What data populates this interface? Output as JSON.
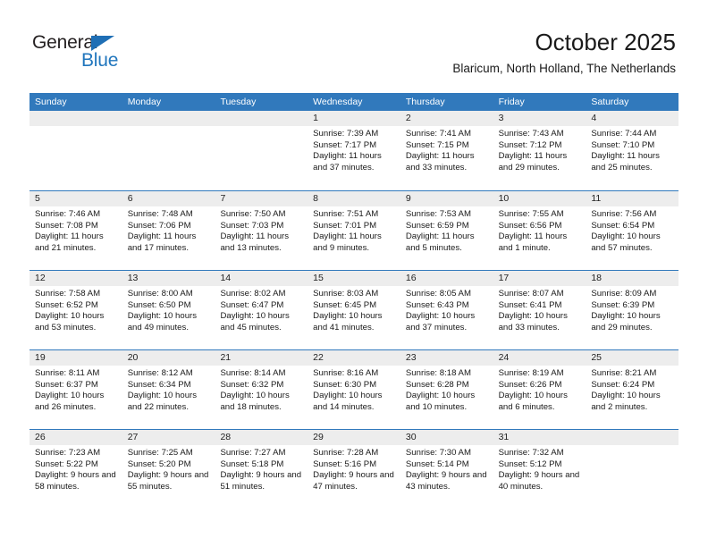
{
  "brand": {
    "name_top": "General",
    "name_bottom": "Blue"
  },
  "header": {
    "title": "October 2025",
    "subtitle": "Blaricum, North Holland, The Netherlands"
  },
  "weekdays": [
    "Sunday",
    "Monday",
    "Tuesday",
    "Wednesday",
    "Thursday",
    "Friday",
    "Saturday"
  ],
  "colors": {
    "header_blue": "#3179bc",
    "logo_blue": "#2176bd",
    "day_strip_gray": "#ededed"
  },
  "labels": {
    "sunrise_prefix": "Sunrise:",
    "sunset_prefix": "Sunset:",
    "daylight_prefix": "Daylight:"
  },
  "weeks": [
    [
      {
        "day": "",
        "empty": true
      },
      {
        "day": "",
        "empty": true
      },
      {
        "day": "",
        "empty": true
      },
      {
        "day": "1",
        "sunrise": "Sunrise: 7:39 AM",
        "sunset": "Sunset: 7:17 PM",
        "daylight": "Daylight: 11 hours and 37 minutes."
      },
      {
        "day": "2",
        "sunrise": "Sunrise: 7:41 AM",
        "sunset": "Sunset: 7:15 PM",
        "daylight": "Daylight: 11 hours and 33 minutes."
      },
      {
        "day": "3",
        "sunrise": "Sunrise: 7:43 AM",
        "sunset": "Sunset: 7:12 PM",
        "daylight": "Daylight: 11 hours and 29 minutes."
      },
      {
        "day": "4",
        "sunrise": "Sunrise: 7:44 AM",
        "sunset": "Sunset: 7:10 PM",
        "daylight": "Daylight: 11 hours and 25 minutes."
      }
    ],
    [
      {
        "day": "5",
        "sunrise": "Sunrise: 7:46 AM",
        "sunset": "Sunset: 7:08 PM",
        "daylight": "Daylight: 11 hours and 21 minutes."
      },
      {
        "day": "6",
        "sunrise": "Sunrise: 7:48 AM",
        "sunset": "Sunset: 7:06 PM",
        "daylight": "Daylight: 11 hours and 17 minutes."
      },
      {
        "day": "7",
        "sunrise": "Sunrise: 7:50 AM",
        "sunset": "Sunset: 7:03 PM",
        "daylight": "Daylight: 11 hours and 13 minutes."
      },
      {
        "day": "8",
        "sunrise": "Sunrise: 7:51 AM",
        "sunset": "Sunset: 7:01 PM",
        "daylight": "Daylight: 11 hours and 9 minutes."
      },
      {
        "day": "9",
        "sunrise": "Sunrise: 7:53 AM",
        "sunset": "Sunset: 6:59 PM",
        "daylight": "Daylight: 11 hours and 5 minutes."
      },
      {
        "day": "10",
        "sunrise": "Sunrise: 7:55 AM",
        "sunset": "Sunset: 6:56 PM",
        "daylight": "Daylight: 11 hours and 1 minute."
      },
      {
        "day": "11",
        "sunrise": "Sunrise: 7:56 AM",
        "sunset": "Sunset: 6:54 PM",
        "daylight": "Daylight: 10 hours and 57 minutes."
      }
    ],
    [
      {
        "day": "12",
        "sunrise": "Sunrise: 7:58 AM",
        "sunset": "Sunset: 6:52 PM",
        "daylight": "Daylight: 10 hours and 53 minutes."
      },
      {
        "day": "13",
        "sunrise": "Sunrise: 8:00 AM",
        "sunset": "Sunset: 6:50 PM",
        "daylight": "Daylight: 10 hours and 49 minutes."
      },
      {
        "day": "14",
        "sunrise": "Sunrise: 8:02 AM",
        "sunset": "Sunset: 6:47 PM",
        "daylight": "Daylight: 10 hours and 45 minutes."
      },
      {
        "day": "15",
        "sunrise": "Sunrise: 8:03 AM",
        "sunset": "Sunset: 6:45 PM",
        "daylight": "Daylight: 10 hours and 41 minutes."
      },
      {
        "day": "16",
        "sunrise": "Sunrise: 8:05 AM",
        "sunset": "Sunset: 6:43 PM",
        "daylight": "Daylight: 10 hours and 37 minutes."
      },
      {
        "day": "17",
        "sunrise": "Sunrise: 8:07 AM",
        "sunset": "Sunset: 6:41 PM",
        "daylight": "Daylight: 10 hours and 33 minutes."
      },
      {
        "day": "18",
        "sunrise": "Sunrise: 8:09 AM",
        "sunset": "Sunset: 6:39 PM",
        "daylight": "Daylight: 10 hours and 29 minutes."
      }
    ],
    [
      {
        "day": "19",
        "sunrise": "Sunrise: 8:11 AM",
        "sunset": "Sunset: 6:37 PM",
        "daylight": "Daylight: 10 hours and 26 minutes."
      },
      {
        "day": "20",
        "sunrise": "Sunrise: 8:12 AM",
        "sunset": "Sunset: 6:34 PM",
        "daylight": "Daylight: 10 hours and 22 minutes."
      },
      {
        "day": "21",
        "sunrise": "Sunrise: 8:14 AM",
        "sunset": "Sunset: 6:32 PM",
        "daylight": "Daylight: 10 hours and 18 minutes."
      },
      {
        "day": "22",
        "sunrise": "Sunrise: 8:16 AM",
        "sunset": "Sunset: 6:30 PM",
        "daylight": "Daylight: 10 hours and 14 minutes."
      },
      {
        "day": "23",
        "sunrise": "Sunrise: 8:18 AM",
        "sunset": "Sunset: 6:28 PM",
        "daylight": "Daylight: 10 hours and 10 minutes."
      },
      {
        "day": "24",
        "sunrise": "Sunrise: 8:19 AM",
        "sunset": "Sunset: 6:26 PM",
        "daylight": "Daylight: 10 hours and 6 minutes."
      },
      {
        "day": "25",
        "sunrise": "Sunrise: 8:21 AM",
        "sunset": "Sunset: 6:24 PM",
        "daylight": "Daylight: 10 hours and 2 minutes."
      }
    ],
    [
      {
        "day": "26",
        "sunrise": "Sunrise: 7:23 AM",
        "sunset": "Sunset: 5:22 PM",
        "daylight": "Daylight: 9 hours and 58 minutes."
      },
      {
        "day": "27",
        "sunrise": "Sunrise: 7:25 AM",
        "sunset": "Sunset: 5:20 PM",
        "daylight": "Daylight: 9 hours and 55 minutes."
      },
      {
        "day": "28",
        "sunrise": "Sunrise: 7:27 AM",
        "sunset": "Sunset: 5:18 PM",
        "daylight": "Daylight: 9 hours and 51 minutes."
      },
      {
        "day": "29",
        "sunrise": "Sunrise: 7:28 AM",
        "sunset": "Sunset: 5:16 PM",
        "daylight": "Daylight: 9 hours and 47 minutes."
      },
      {
        "day": "30",
        "sunrise": "Sunrise: 7:30 AM",
        "sunset": "Sunset: 5:14 PM",
        "daylight": "Daylight: 9 hours and 43 minutes."
      },
      {
        "day": "31",
        "sunrise": "Sunrise: 7:32 AM",
        "sunset": "Sunset: 5:12 PM",
        "daylight": "Daylight: 9 hours and 40 minutes."
      },
      {
        "day": "",
        "empty": true
      }
    ]
  ]
}
